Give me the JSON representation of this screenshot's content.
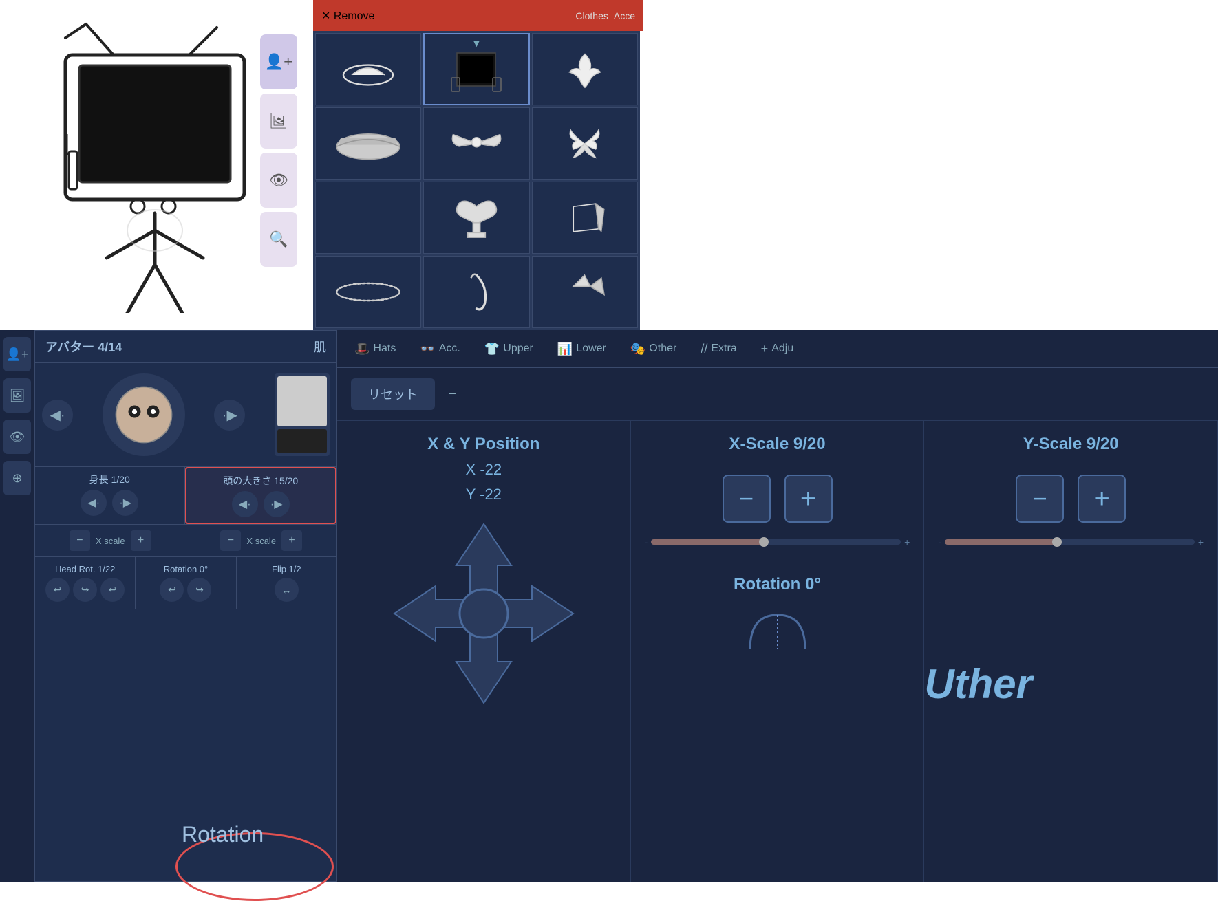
{
  "top": {
    "remove_label": "✕ Remove",
    "clothes_label": "Clothes",
    "acce_label": "Acce",
    "sidebar_icons": [
      "👤+",
      "🖼",
      "👁",
      "🔍"
    ],
    "grid_items": [
      {
        "id": 1,
        "type": "hat_boat",
        "selected": false
      },
      {
        "id": 2,
        "type": "tv_head",
        "selected": true
      },
      {
        "id": 3,
        "type": "flower",
        "selected": false
      },
      {
        "id": 4,
        "type": "visor",
        "selected": false
      },
      {
        "id": 5,
        "type": "bow_knot",
        "selected": false
      },
      {
        "id": 6,
        "type": "butterfly",
        "selected": false
      },
      {
        "id": 7,
        "type": "empty",
        "selected": false
      },
      {
        "id": 8,
        "type": "big_bow",
        "selected": false
      },
      {
        "id": 9,
        "type": "leaf",
        "selected": false
      },
      {
        "id": 10,
        "type": "ring",
        "selected": false
      },
      {
        "id": 11,
        "type": "hook",
        "selected": false
      },
      {
        "id": 12,
        "type": "ear_piece",
        "selected": false
      }
    ]
  },
  "avatar_panel": {
    "title": "アバター 4/14",
    "skin_label": "肌",
    "height_label": "身長 1/20",
    "head_size_label": "頭の大きさ 15/20",
    "head_rot_label": "Head Rot. 1/22",
    "rotation_label": "Rotation 0°",
    "flip_label": "Flip 1/2",
    "x_scale_label": "X\nscale"
  },
  "adjust": {
    "reset_label": "リセット",
    "tabs": [
      {
        "label": "Hats",
        "icon": "🎩"
      },
      {
        "label": "Acc.",
        "icon": "👓"
      },
      {
        "label": "Upper",
        "icon": "👕"
      },
      {
        "label": "Lower",
        "icon": "👖"
      },
      {
        "label": "Other",
        "icon": "🎭"
      },
      {
        "label": "Extra",
        "icon": "//"
      },
      {
        "label": "Adju",
        "icon": "➕"
      }
    ],
    "xy_title": "X & Y Position",
    "x_value": "X -22",
    "y_value": "Y -22",
    "x_scale_title": "X-Scale 9/20",
    "y_scale_title": "Y-Scale 9/20",
    "rotation_title": "Rotation 0°",
    "slider_minus": "-",
    "slider_plus": "+"
  },
  "uther_text": "Uther",
  "rotation_bottom_label": "Rotation"
}
